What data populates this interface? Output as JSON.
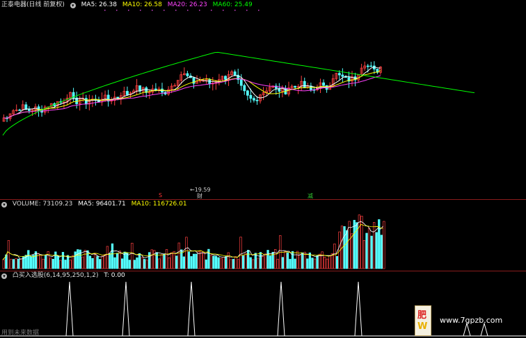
{
  "price_panel": {
    "stock_name": "正泰电器(日线 前复权)",
    "ma5": "MA5: 26.38",
    "ma10": "MA10: 26.58",
    "ma20": "MA20: 26.23",
    "ma60": "MA60: 25.49",
    "low_marker": "←19.59",
    "badge_s": "S",
    "badge_cai": "财",
    "badge_jian": "减"
  },
  "volume_panel": {
    "volume": "VOLUME: 73109.23",
    "ma5": "MA5: 96401.71",
    "ma10": "MA10: 116726.01"
  },
  "indicator_panel": {
    "name": "凸买入选股(6,14,95,250,1,2)",
    "t_value": "T: 0.00"
  },
  "footer_note": "用到未来数据",
  "watermark": {
    "glyph_1": "肥",
    "glyph_2": "W",
    "site": "www.7gpzb.com"
  },
  "colors": {
    "up": "#ff4040",
    "down": "#54ffff",
    "ma5": "#ffffff",
    "ma10": "#ffff00",
    "ma20": "#ff40ff",
    "ma60": "#00ff00",
    "separator": "#8a1c1c"
  }
}
